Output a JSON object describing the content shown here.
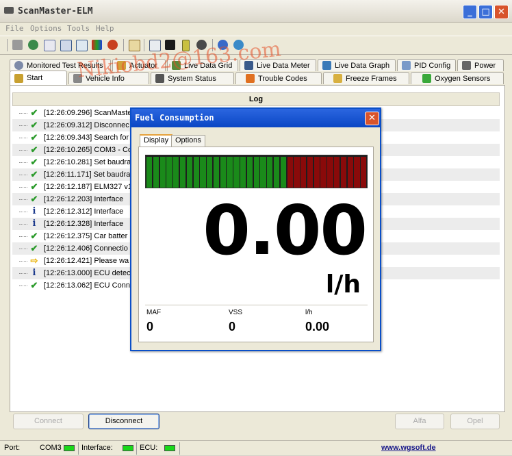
{
  "window": {
    "title": "ScanMaster-ELM"
  },
  "menu": [
    "File",
    "Options",
    "Tools",
    "Help"
  ],
  "toolbar_icons": [
    "wrench-icon",
    "globe-icon",
    "document-icon",
    "grid-icon",
    "chart-icon",
    "colorbars-icon",
    "person-icon",
    "clipboard-icon",
    "monitor-icon",
    "terminal-icon",
    "battery-icon",
    "gauge-icon",
    "info-icon",
    "globe-help-icon"
  ],
  "tabs_row1": [
    {
      "label": "Monitored Test Results",
      "icon": "gear-icon",
      "color": "#7d8aa8"
    },
    {
      "label": "Actuator",
      "icon": "actuator-icon",
      "color": "#d1a23a"
    },
    {
      "label": "Live Data Grid",
      "icon": "grid-icon",
      "color": "#5a8a3a"
    },
    {
      "label": "Live Data Meter",
      "icon": "meter-icon",
      "color": "#3a5a8a"
    },
    {
      "label": "Live Data Graph",
      "icon": "graph-icon",
      "color": "#3a7ab8"
    },
    {
      "label": "PID Config",
      "icon": "config-icon",
      "color": "#7a9ac8"
    },
    {
      "label": "Power",
      "icon": "power-icon",
      "color": "#666666"
    }
  ],
  "tabs_row2": [
    {
      "label": "Start",
      "icon": "home-icon",
      "color": "#c8a030"
    },
    {
      "label": "Vehicle Info",
      "icon": "car-icon",
      "color": "#888888"
    },
    {
      "label": "System Status",
      "icon": "status-icon",
      "color": "#555555"
    },
    {
      "label": "Trouble Codes",
      "icon": "warning-icon",
      "color": "#e07020"
    },
    {
      "label": "Freeze Frames",
      "icon": "freeze-icon",
      "color": "#d8b040"
    },
    {
      "label": "Oxygen Sensors",
      "icon": "oxygen-icon",
      "color": "#3aa83a"
    }
  ],
  "log": {
    "header": "Log",
    "rows": [
      {
        "type": "ok",
        "text": "[12:26:09.296] ScanMaste"
      },
      {
        "type": "ok",
        "text": "[12:26:09.312] Disconnec"
      },
      {
        "type": "ok",
        "text": "[12:26:09.343] Search for"
      },
      {
        "type": "ok",
        "text": "[12:26:10.265] COM3 - Co"
      },
      {
        "type": "ok",
        "text": "[12:26:10.281] Set baudra"
      },
      {
        "type": "ok",
        "text": "[12:26:11.171] Set baudra"
      },
      {
        "type": "ok",
        "text": "[12:26:12.187] ELM327 v1"
      },
      {
        "type": "ok",
        "text": "[12:26:12.203] Interface"
      },
      {
        "type": "info",
        "text": "[12:26:12.312] Interface"
      },
      {
        "type": "info",
        "text": "[12:26:12.328] Interface"
      },
      {
        "type": "ok",
        "text": "[12:26:12.375] Car batter"
      },
      {
        "type": "ok",
        "text": "[12:26:12.406] Connectio"
      },
      {
        "type": "arrow",
        "text": "[12:26:12.421] Please wa"
      },
      {
        "type": "info",
        "text": "[12:26:13.000] ECU detec"
      },
      {
        "type": "ok",
        "text": "[12:26:13.062] ECU Conn"
      }
    ]
  },
  "buttons": {
    "connect": "Connect",
    "disconnect": "Disconnect",
    "alfa": "Alfa",
    "opel": "Opel"
  },
  "status": {
    "port_label": "Port:",
    "port_value": "COM3",
    "interface_label": "Interface:",
    "ecu_label": "ECU:",
    "link": "www.wgsoft.de",
    "led_color": "#1ad81a"
  },
  "dialog": {
    "title": "Fuel Consumption",
    "tabs": [
      "Display",
      "Options"
    ],
    "bar": {
      "green_segments": 21,
      "red_segments": 12,
      "green": "#1a8a1a",
      "red": "#8a0a0a"
    },
    "value": "0.00",
    "unit": "l/h",
    "fields": [
      {
        "label": "MAF",
        "value": "0"
      },
      {
        "label": "VSS",
        "value": "0"
      },
      {
        "label": "l/h",
        "value": "0.00"
      }
    ]
  },
  "watermark": "Nikiobd2@163.com"
}
